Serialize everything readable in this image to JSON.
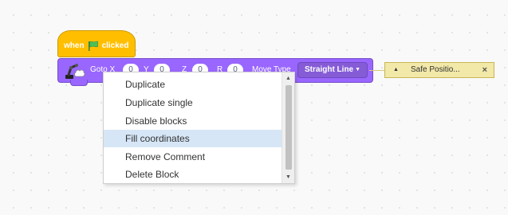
{
  "hat_block": {
    "when": "when",
    "clicked": "clicked",
    "flag_icon": "green-flag-icon"
  },
  "motion_block": {
    "goto_label": "Goto X",
    "x_value": "0",
    "y_label": "Y",
    "y_value": "0",
    "z_label": "Z",
    "z_value": "0",
    "r_label": "R",
    "r_value": "0",
    "move_type_label": "Move Type",
    "move_type_value": "Straight Line",
    "robot_icon": "robot-arm-icon"
  },
  "comment": {
    "text": "Safe Positio...",
    "close": "×"
  },
  "context_menu": {
    "items": [
      "Duplicate",
      "Duplicate single",
      "Disable blocks",
      "Fill coordinates",
      "Remove Comment",
      "Delete Block"
    ],
    "highlighted": "Fill coordinates"
  },
  "colors": {
    "hat": "#ffbf00",
    "motion": "#9966ff",
    "menu_highlight": "#d6e6f6",
    "comment": "#f2e8a8"
  }
}
